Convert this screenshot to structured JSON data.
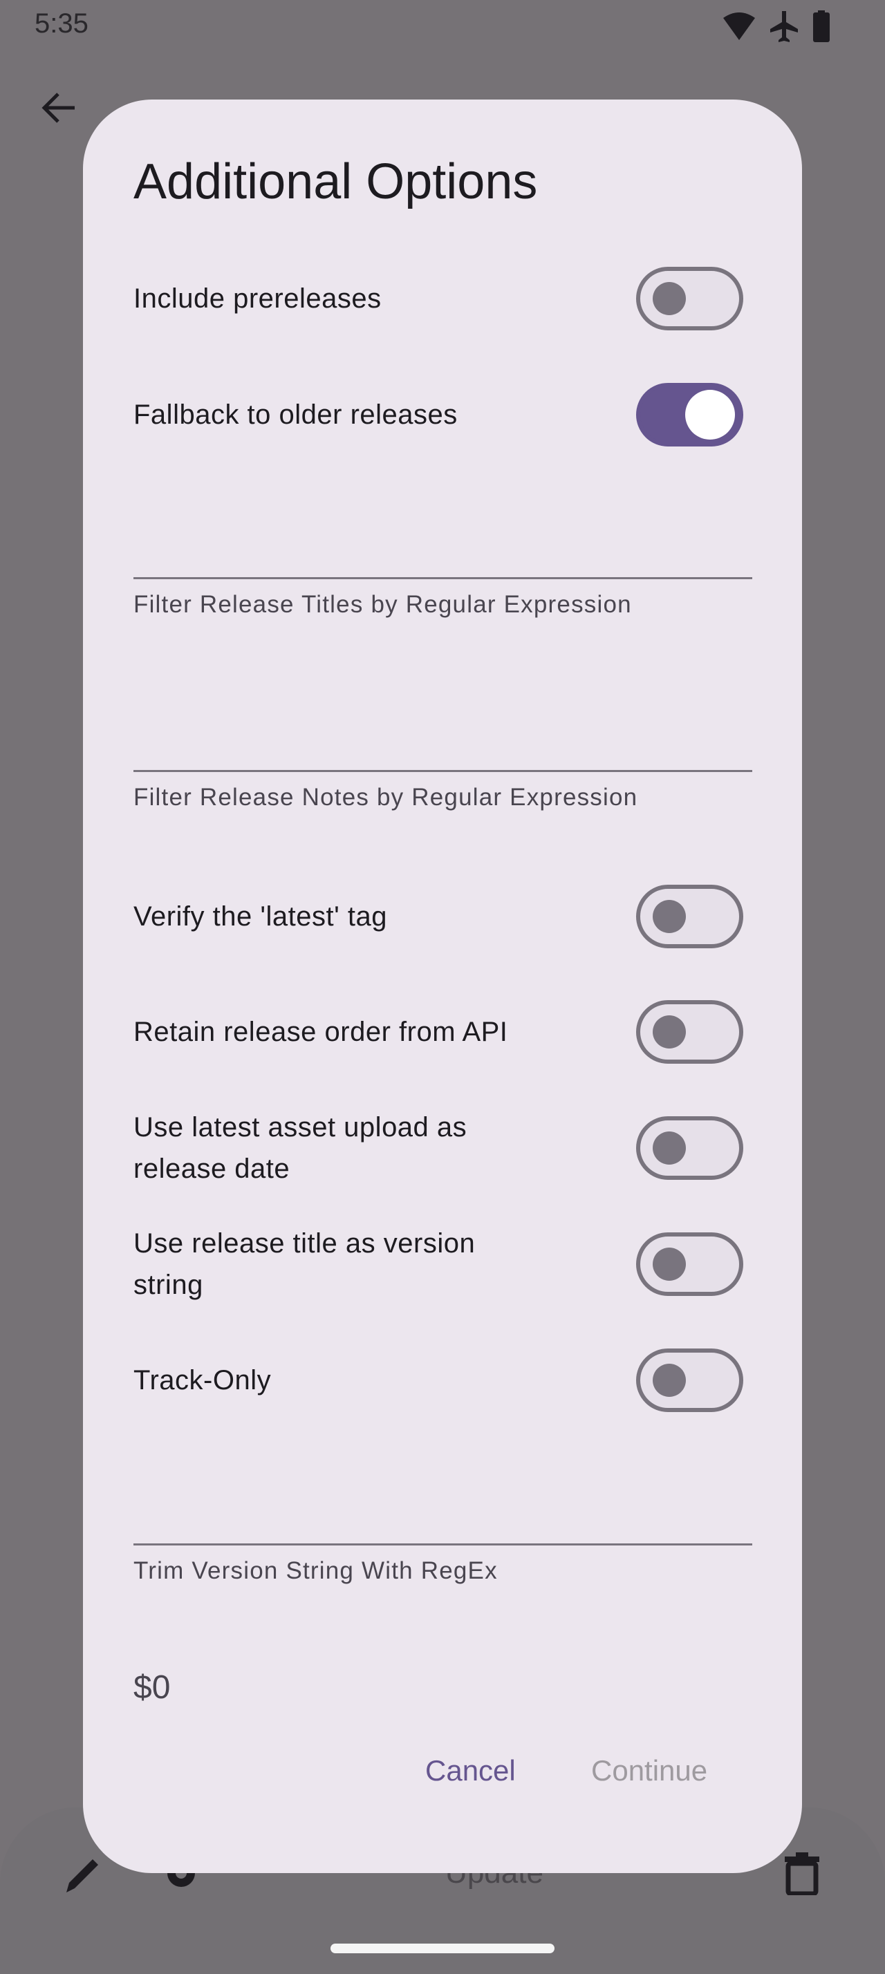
{
  "status_bar": {
    "time": "5:35",
    "icons": [
      "wifi-icon",
      "airplane-icon",
      "battery-icon"
    ]
  },
  "background": {
    "update_label": "Update",
    "icons": [
      "back-arrow-icon",
      "pencil-icon",
      "gear-icon",
      "trash-icon"
    ]
  },
  "dialog": {
    "title": "Additional Options",
    "toggles": [
      {
        "label": "Include prereleases",
        "on": false
      },
      {
        "label": "Fallback to older releases",
        "on": true
      },
      {
        "label": "Verify the 'latest' tag",
        "on": false
      },
      {
        "label": "Retain release order from API",
        "on": false
      },
      {
        "label": "Use latest asset upload as release date",
        "on": false
      },
      {
        "label": "Use release title as version string",
        "on": false
      },
      {
        "label": "Track-Only",
        "on": false
      }
    ],
    "fields": [
      {
        "label": "Filter Release Titles by Regular Expression",
        "value": ""
      },
      {
        "label": "Filter Release Notes by Regular Expression",
        "value": ""
      },
      {
        "label": "Trim Version String With RegEx",
        "value": ""
      }
    ],
    "replacement_value": "$0",
    "cancel_label": "Cancel",
    "continue_label": "Continue"
  },
  "colors": {
    "accent": "#65558F",
    "dialog_bg": "#ECE6EE",
    "scrim": "#767276",
    "outline": "#79747E"
  }
}
